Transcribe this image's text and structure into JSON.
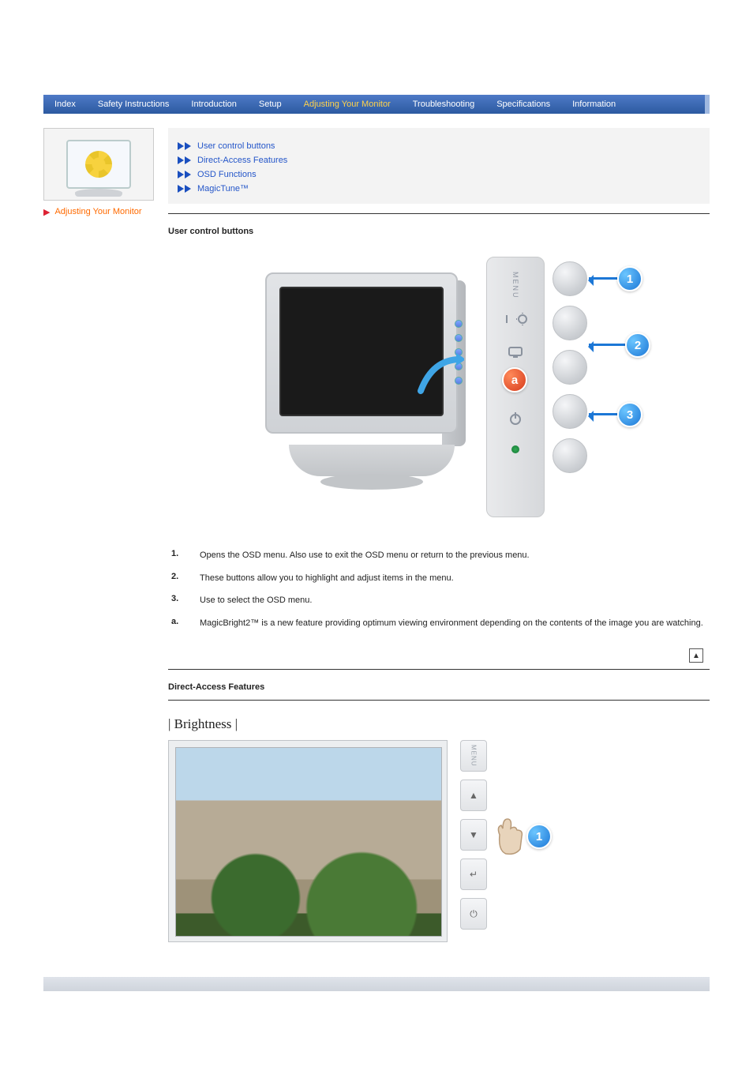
{
  "nav": {
    "items": [
      {
        "label": "Index"
      },
      {
        "label": "Safety Instructions"
      },
      {
        "label": "Introduction"
      },
      {
        "label": "Setup"
      },
      {
        "label": "Adjusting Your Monitor"
      },
      {
        "label": "Troubleshooting"
      },
      {
        "label": "Specifications"
      },
      {
        "label": "Information"
      }
    ],
    "active_index": 4
  },
  "sidebar": {
    "label": "Adjusting Your Monitor"
  },
  "sublinks": [
    {
      "label": "User control buttons"
    },
    {
      "label": "Direct-Access Features"
    },
    {
      "label": "OSD Functions"
    },
    {
      "label": "MagicTune™"
    }
  ],
  "sections": {
    "user_control_buttons": {
      "title": "User control buttons",
      "panel_label": "MENU",
      "callouts": {
        "one": "1",
        "two": "2",
        "three": "3",
        "a": "a"
      },
      "descriptions": [
        {
          "num": "1.",
          "text": "Opens the OSD menu. Also use to exit the OSD menu or return to the previous menu."
        },
        {
          "num": "2.",
          "text": "These buttons allow you to highlight and adjust items in the menu."
        },
        {
          "num": "3.",
          "text": "Use to select the OSD menu."
        },
        {
          "num": "a.",
          "text": "MagicBright2™ is a new feature providing optimum viewing environment depending on the contents of the image you are watching."
        }
      ]
    },
    "direct_access": {
      "title": "Direct-Access Features",
      "brightness_title": "| Brightness |",
      "panel": {
        "menu": "MENU",
        "up": "▲",
        "down": "▼",
        "enter": "↵",
        "power": "⏻"
      },
      "callout": "1"
    }
  }
}
